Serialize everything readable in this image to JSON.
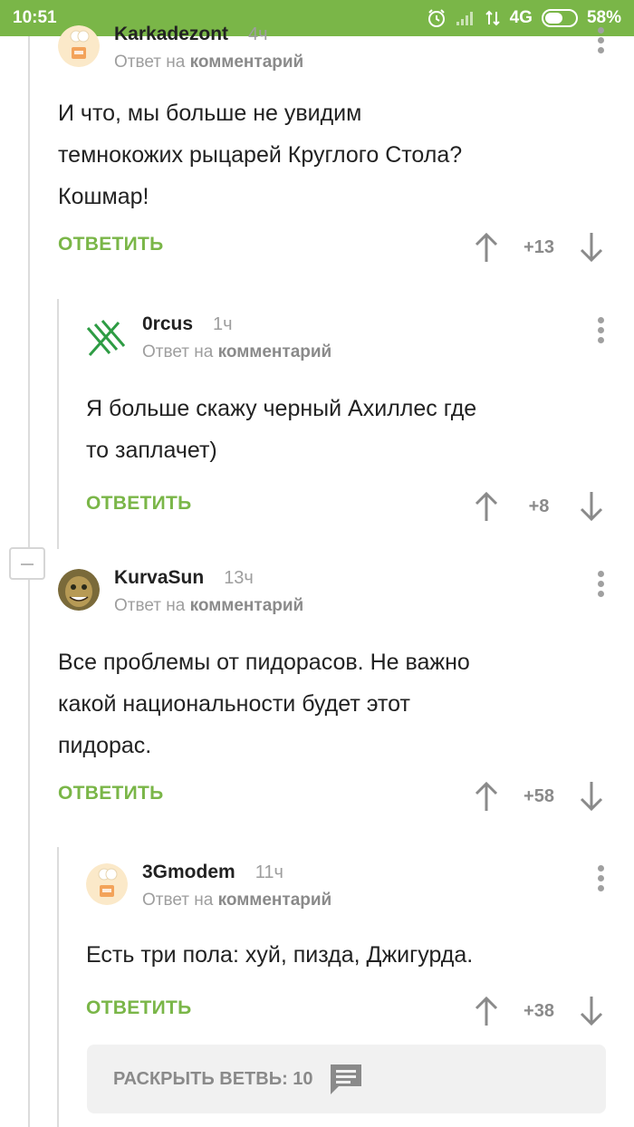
{
  "status_bar": {
    "time": "10:51",
    "network": "4G",
    "battery": "58%",
    "battery_level": 0.58
  },
  "reply_to_prefix": "Ответ на",
  "reply_to_target": "комментарий",
  "reply_label": "ОТВЕТИТЬ",
  "comments": [
    {
      "user": "Karkadezont",
      "time": "4ч",
      "text_lines": [
        "И что, мы больше не увидим",
        "темнокожих рыцарей Круглого Стола?",
        "Кошмар!"
      ],
      "score": "+13"
    },
    {
      "user": "0rcus",
      "time": "1ч",
      "text_lines": [
        "Я больше скажу черный Ахиллес где",
        "то заплачет)"
      ],
      "score": "+8"
    },
    {
      "user": "KurvaSun",
      "time": "13ч",
      "text_lines": [
        "Все проблемы от пидорасов. Не важно",
        "какой национальности будет этот",
        "пидорас."
      ],
      "score": "+58"
    },
    {
      "user": "3Gmodem",
      "time": "11ч",
      "text_lines": [
        "Есть три пола: хуй, пизда, Джигурда."
      ],
      "score": "+38"
    }
  ],
  "expand_branch": {
    "label": "РАСКРЫТЬ ВЕТВЬ: 10"
  },
  "colors": {
    "accent": "#7ab648",
    "muted": "#9e9e9e"
  }
}
